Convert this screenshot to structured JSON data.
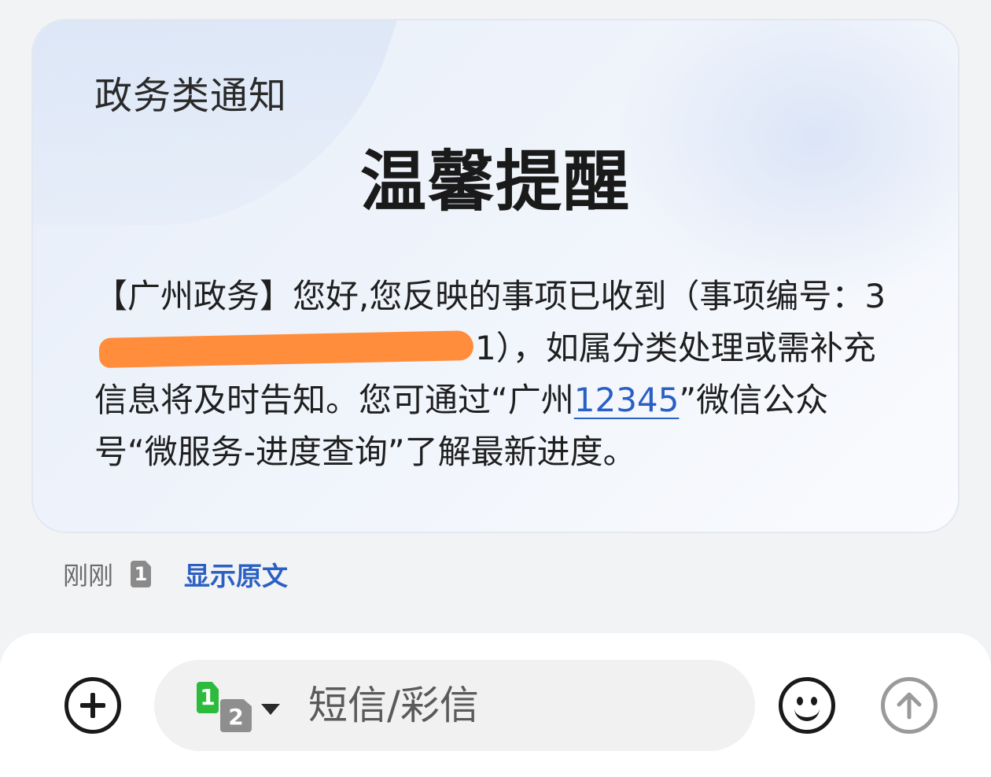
{
  "message_card": {
    "category": "政务类通知",
    "title": "温馨提醒",
    "body_part1": "【广州政务】您好,您反映的事项已收到（事项编号：3",
    "redacted_visible_tail": "1），",
    "body_part2": "如属分类处理或需补充信息将及时告知。您可通过“广州",
    "body_link": "12345",
    "body_part3": "”微信公众号“微服务-进度查询”了解最新进度。"
  },
  "message_meta": {
    "time": "刚刚",
    "sim_badge": "1",
    "show_original": "显示原文"
  },
  "composer": {
    "sim_primary": "1",
    "sim_secondary": "2",
    "placeholder": "短信/彩信"
  },
  "colors": {
    "link": "#2a5fc4",
    "redaction": "#ff8d3b",
    "sim1": "#2dbb3e",
    "sim2": "#8e8e8e"
  },
  "icons": {
    "attach": "plus-circle-icon",
    "emoji": "smiley-icon",
    "send": "arrow-up-circle-icon",
    "sim_dropdown": "caret-down-icon"
  }
}
